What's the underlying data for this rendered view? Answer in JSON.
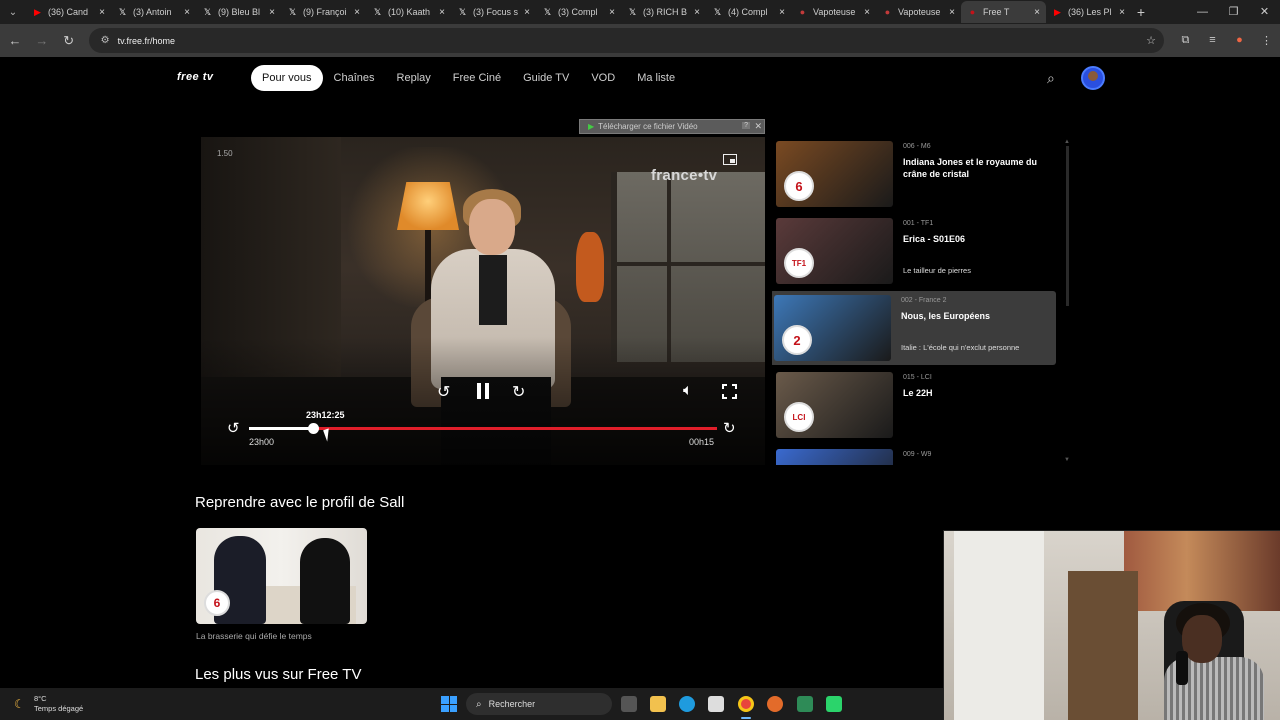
{
  "browser": {
    "tabs": [
      {
        "title": "(36) Cand",
        "icon": "youtube-icon",
        "color": "#ff0000"
      },
      {
        "title": "(3) Antoin",
        "icon": "x-icon",
        "color": "#ffffff"
      },
      {
        "title": "(9) Bleu Bl",
        "icon": "x-icon",
        "color": "#ffffff"
      },
      {
        "title": "(9) Françoi",
        "icon": "x-icon",
        "color": "#ffffff"
      },
      {
        "title": "(10) Kaath",
        "icon": "x-icon",
        "color": "#ffffff"
      },
      {
        "title": "(3) Focus s",
        "icon": "x-icon",
        "color": "#ffffff"
      },
      {
        "title": "(3) Compl",
        "icon": "x-icon",
        "color": "#ffffff"
      },
      {
        "title": "(3) RICH B",
        "icon": "x-icon",
        "color": "#ffffff"
      },
      {
        "title": "(4) Compl",
        "icon": "x-icon",
        "color": "#ffffff"
      },
      {
        "title": "Vapoteuse",
        "icon": "site-icon",
        "color": "#c23a3a"
      },
      {
        "title": "Vapoteuse",
        "icon": "site-icon",
        "color": "#c23a3a"
      },
      {
        "title": "Free T",
        "icon": "free-icon",
        "color": "#c4121a",
        "active": true
      },
      {
        "title": "(36) Les Pl",
        "icon": "youtube-icon",
        "color": "#ff0000"
      }
    ],
    "url": "tv.free.fr/home"
  },
  "site": {
    "logo": "free tv",
    "nav": [
      "Pour vous",
      "Chaînes",
      "Replay",
      "Free Ciné",
      "Guide TV",
      "VOD",
      "Ma liste"
    ],
    "active_nav": "Pour vous"
  },
  "download_banner": {
    "label": "Télécharger ce fichier Vidéo",
    "help": "?"
  },
  "player": {
    "speed": "1.50",
    "channel_brand": "france•tv",
    "current_time": "23h12:25",
    "start_time": "23h00",
    "end_time": "00h15",
    "progress": 0.137
  },
  "channels": [
    {
      "num": "006 - M6",
      "title": "Indiana Jones et le royaume du crâne de cristal",
      "subtitle": "",
      "logo": "6",
      "thumb": "#7a4a22"
    },
    {
      "num": "001 - TF1",
      "title": "Erica - S01E06",
      "subtitle": "Le tailleur de pierres",
      "logo": "TF1",
      "thumb": "#5a3a3a"
    },
    {
      "num": "002 - France 2",
      "title": "Nous, les Européens",
      "subtitle": "Italie : L'école qui n'exclut personne",
      "logo": "2",
      "thumb": "#3d78b8",
      "highlighted": true
    },
    {
      "num": "015 - LCI",
      "title": "Le 22H",
      "subtitle": "",
      "logo": "LCI",
      "thumb": "#6a5a4a"
    },
    {
      "num": "009 - W9",
      "title": "",
      "subtitle": "",
      "logo": "",
      "thumb": "#3a6ad0"
    }
  ],
  "resume": {
    "heading": "Reprendre avec le profil de Sall",
    "card_logo": "6",
    "caption": "La brasserie qui défie le temps"
  },
  "popular": {
    "heading": "Les plus vus sur Free TV"
  },
  "taskbar": {
    "temperature": "8°C",
    "weather": "Temps dégagé",
    "search": "Rechercher"
  },
  "colors": {
    "accent_red": "#e01e2a",
    "free_red": "#c4121a"
  }
}
